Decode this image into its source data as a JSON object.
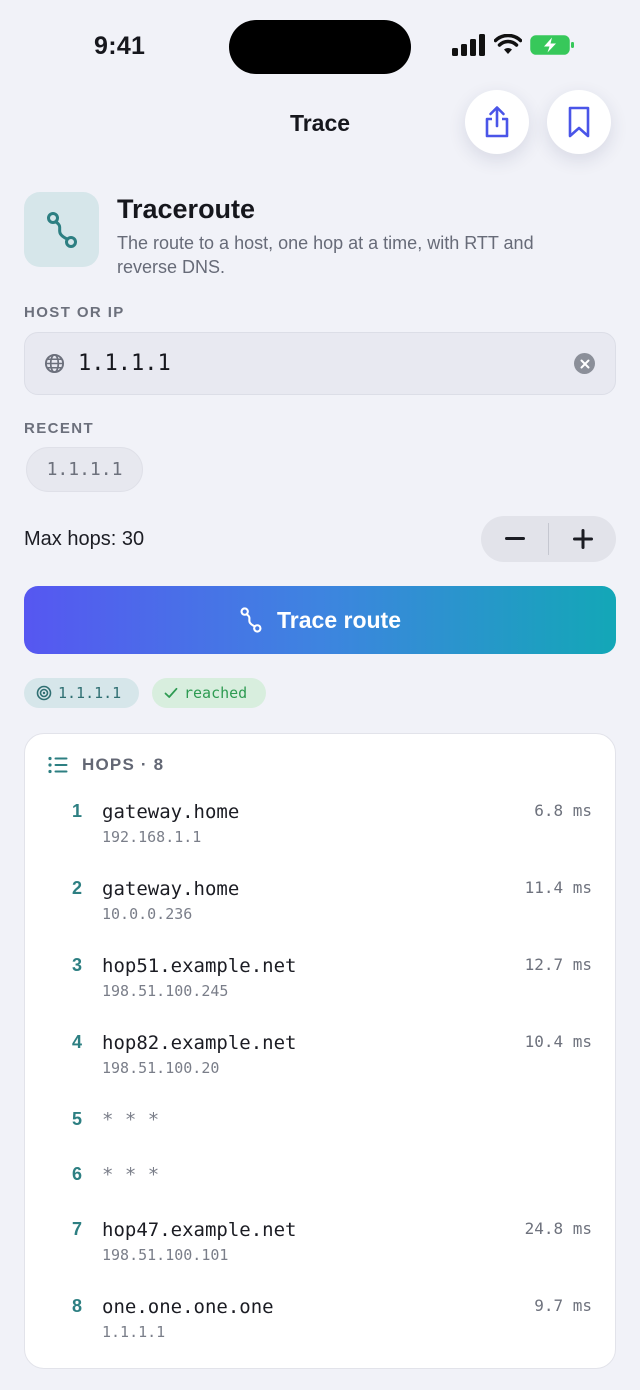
{
  "status_bar": {
    "time": "9:41"
  },
  "nav": {
    "title": "Trace"
  },
  "header": {
    "title": "Traceroute",
    "subtitle": "The route to a host, one hop at a time, with RTT and reverse DNS."
  },
  "host_section": {
    "label": "HOST OR IP",
    "value": "1.1.1.1"
  },
  "recent_section": {
    "label": "RECENT",
    "items": [
      "1.1.1.1"
    ]
  },
  "max_hops": {
    "label": "Max hops: 30",
    "value": 30
  },
  "trace_button": {
    "label": "Trace route"
  },
  "result": {
    "target": "1.1.1.1",
    "state": "reached"
  },
  "hops_card": {
    "title": "HOPS · 8",
    "hops": [
      {
        "num": "1",
        "host": "gateway.home",
        "ip": "192.168.1.1",
        "rtt": "6.8 ms"
      },
      {
        "num": "2",
        "host": "gateway.home",
        "ip": "10.0.0.236",
        "rtt": "11.4 ms"
      },
      {
        "num": "3",
        "host": "hop51.example.net",
        "ip": "198.51.100.245",
        "rtt": "12.7 ms"
      },
      {
        "num": "4",
        "host": "hop82.example.net",
        "ip": "198.51.100.20",
        "rtt": "10.4 ms"
      },
      {
        "num": "5",
        "host": "* * *",
        "ip": "",
        "rtt": ""
      },
      {
        "num": "6",
        "host": "* * *",
        "ip": "",
        "rtt": ""
      },
      {
        "num": "7",
        "host": "hop47.example.net",
        "ip": "198.51.100.101",
        "rtt": "24.8 ms"
      },
      {
        "num": "8",
        "host": "one.one.one.one",
        "ip": "1.1.1.1",
        "rtt": "9.7 ms"
      }
    ]
  },
  "colors": {
    "accent_teal": "#2d7f82",
    "gradient_start": "#5657f1",
    "gradient_end": "#13a7b7",
    "success_green": "#2e9b52",
    "icon_blue": "#4a55e8"
  },
  "icons": {
    "share": "share-icon",
    "bookmark": "bookmark-icon",
    "route": "route-icon",
    "globe": "globe-icon",
    "clear": "clear-icon",
    "minus": "minus-icon",
    "plus": "plus-icon",
    "target": "target-icon",
    "check": "check-icon",
    "list": "list-icon"
  }
}
